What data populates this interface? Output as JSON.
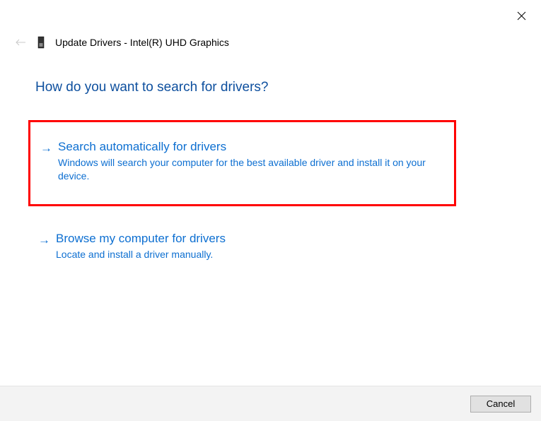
{
  "window": {
    "title": "Update Drivers - Intel(R) UHD Graphics"
  },
  "heading": "How do you want to search for drivers?",
  "options": {
    "auto": {
      "title": "Search automatically for drivers",
      "description": "Windows will search your computer for the best available driver and install it on your device."
    },
    "browse": {
      "title": "Browse my computer for drivers",
      "description": "Locate and install a driver manually."
    }
  },
  "footer": {
    "cancel_label": "Cancel"
  }
}
